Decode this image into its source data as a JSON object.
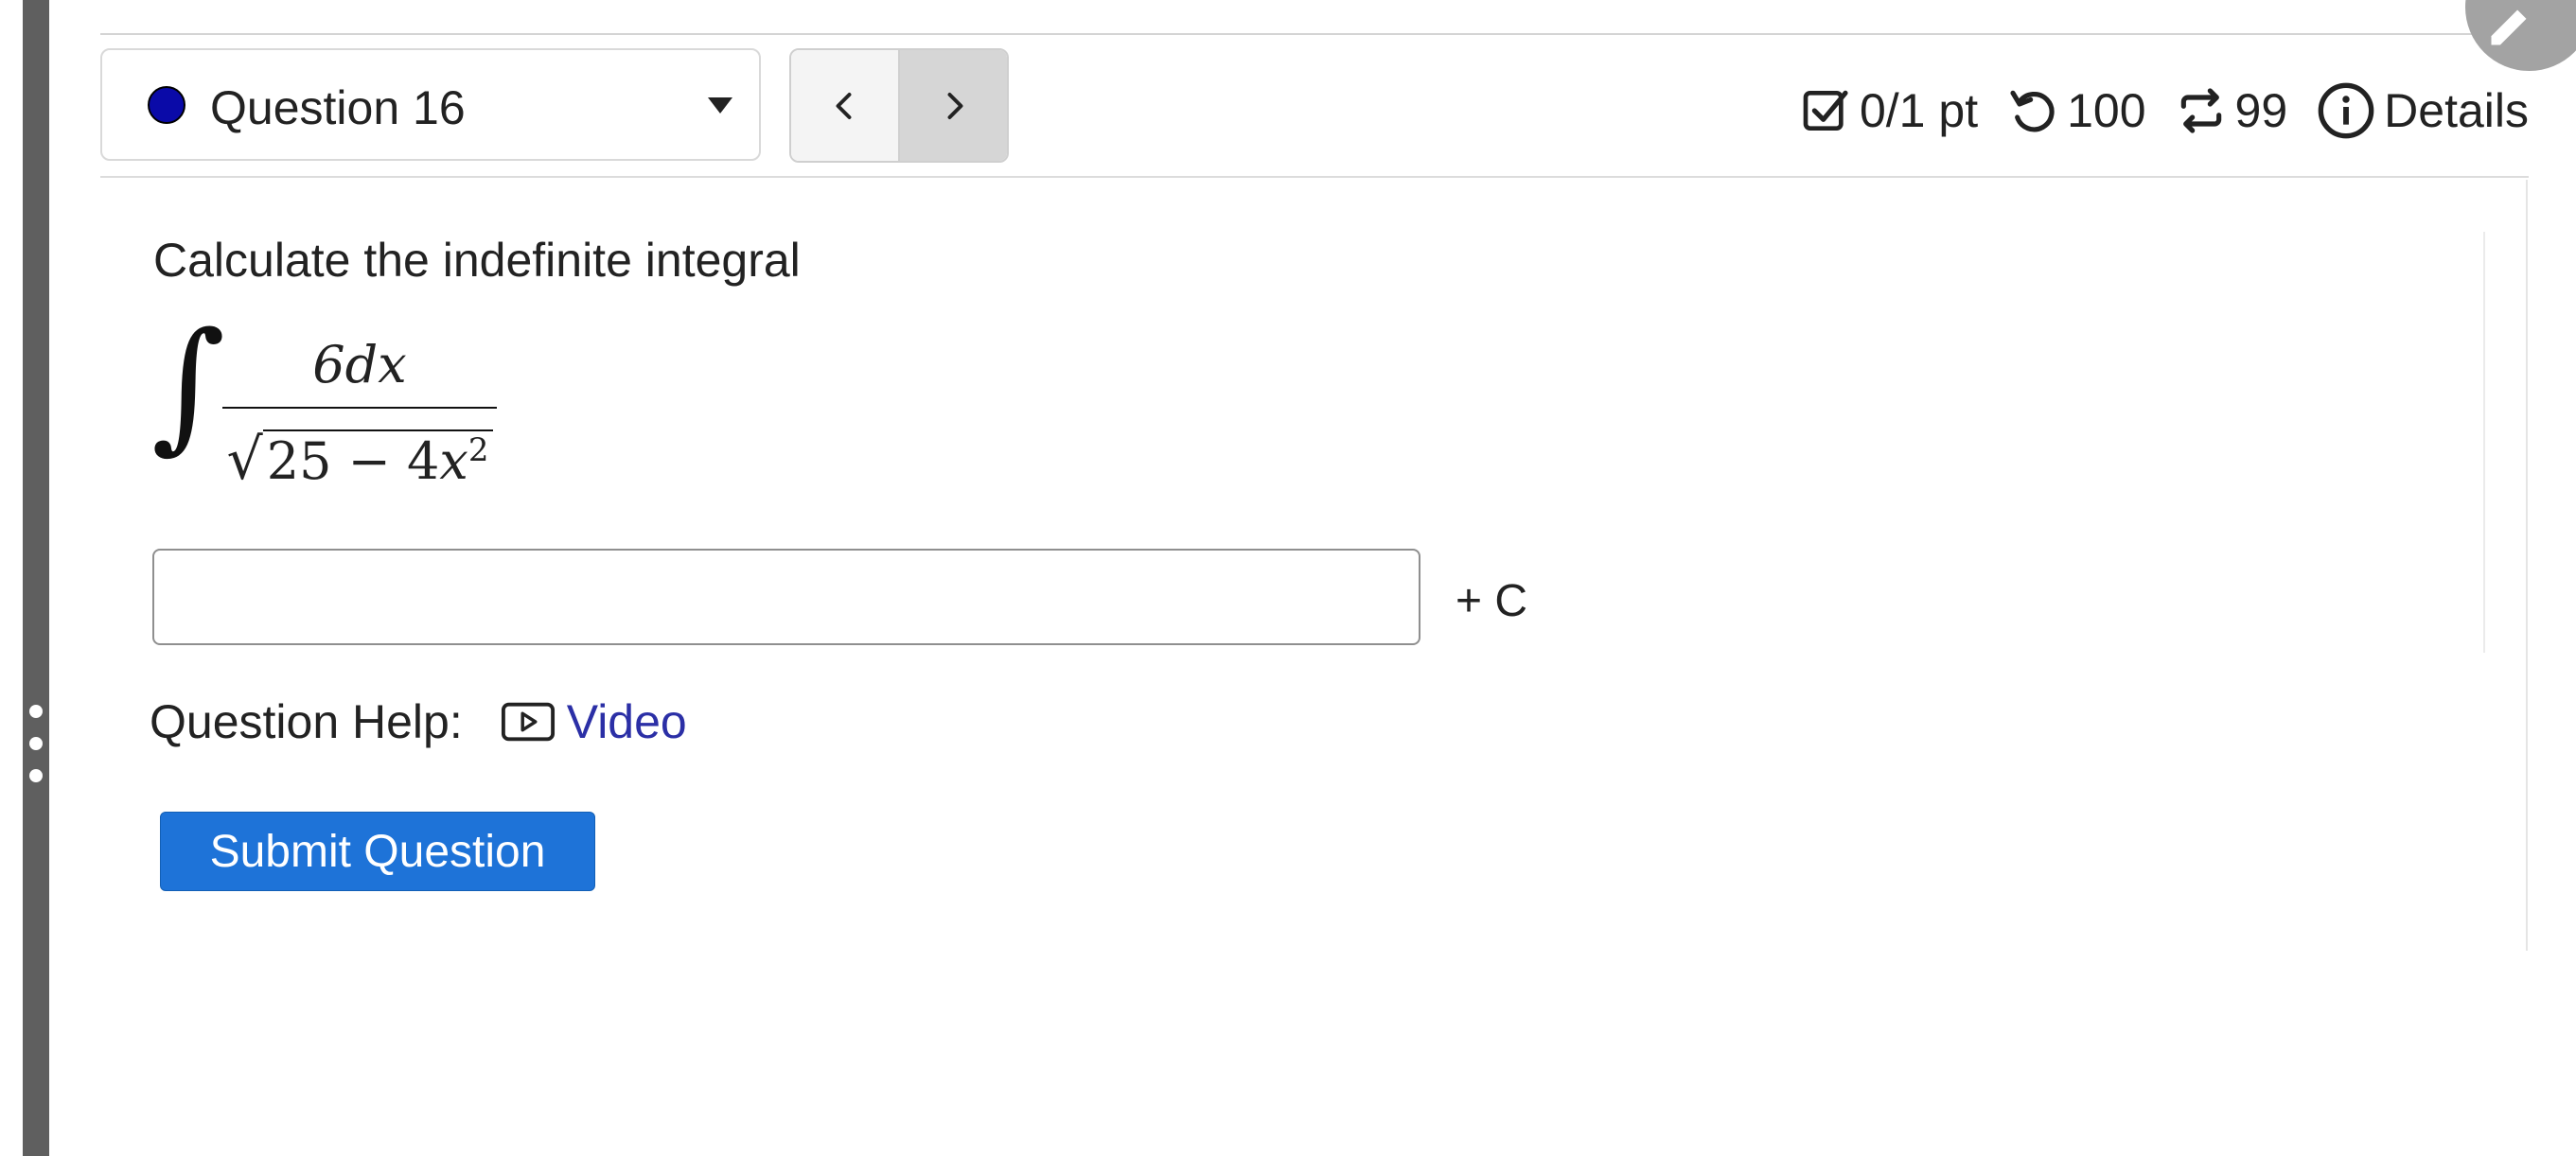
{
  "question_selector": {
    "label": "Question 16",
    "status_color": "#0a0aa8"
  },
  "metrics": {
    "points": "0/1 pt",
    "retries": "100",
    "attempts": "99",
    "details": "Details"
  },
  "question": {
    "prompt": "Calculate the indefinite integral",
    "formula": {
      "numerator": "6dx",
      "denominator_radicand_num": "25",
      "denominator_minus": "−",
      "denominator_coef": "4",
      "denominator_var": "x",
      "denominator_exp": "2"
    },
    "answer": {
      "value": "",
      "suffix": "+ C"
    },
    "help_label": "Question Help:",
    "help_video": "Video",
    "submit_label": "Submit Question"
  },
  "colors": {
    "accent": "#1e73d8",
    "link": "#2b2fa6"
  }
}
